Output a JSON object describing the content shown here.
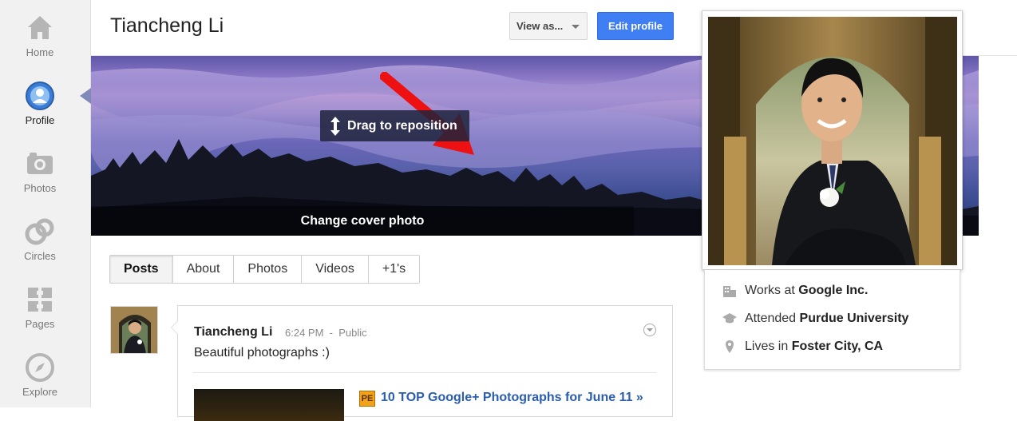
{
  "nav": {
    "items": [
      {
        "label": "Home",
        "icon": "home-icon"
      },
      {
        "label": "Profile",
        "icon": "profile-icon",
        "active": true
      },
      {
        "label": "Photos",
        "icon": "camera-icon"
      },
      {
        "label": "Circles",
        "icon": "circles-icon"
      },
      {
        "label": "Pages",
        "icon": "pages-icon"
      },
      {
        "label": "Explore",
        "icon": "compass-icon"
      }
    ]
  },
  "header": {
    "title": "Tiancheng Li",
    "view_as_label": "View as...",
    "edit_profile_label": "Edit profile"
  },
  "cover": {
    "drag_tip": "Drag to reposition",
    "change_label": "Change cover photo"
  },
  "tabs": [
    {
      "label": "Posts",
      "active": true
    },
    {
      "label": "About"
    },
    {
      "label": "Photos"
    },
    {
      "label": "Videos"
    },
    {
      "label": "+1's"
    }
  ],
  "post": {
    "author": "Tiancheng Li",
    "time": "6:24 PM",
    "separator": "-",
    "visibility": "Public",
    "text": "Beautiful photographs :)",
    "link_icon_text": "PE",
    "link_title": "10 TOP Google+ Photographs for June 11 »"
  },
  "about": {
    "work_prefix": "Works at",
    "work": "Google Inc.",
    "school_prefix": "Attended",
    "school": "Purdue University",
    "location_prefix": "Lives in",
    "location": "Foster City, CA"
  },
  "colors": {
    "accent": "#3f7ef3",
    "link": "#2a5db0",
    "annotation_arrow": "#ee1111"
  }
}
